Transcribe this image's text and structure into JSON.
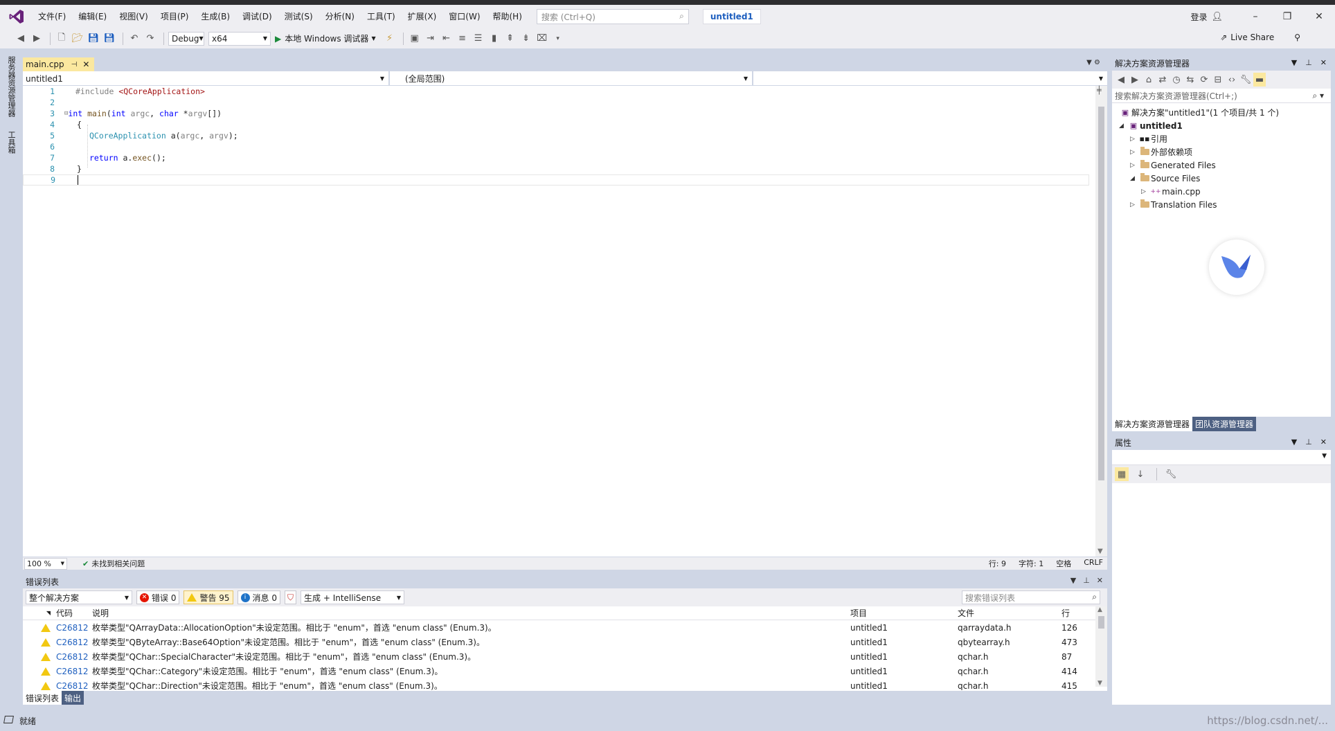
{
  "app": {
    "project_title": "untitled1",
    "login": "登录"
  },
  "menu": [
    "文件(F)",
    "编辑(E)",
    "视图(V)",
    "项目(P)",
    "生成(B)",
    "调试(D)",
    "测试(S)",
    "分析(N)",
    "工具(T)",
    "扩展(X)",
    "窗口(W)",
    "帮助(H)"
  ],
  "search": {
    "placeholder": "搜索 (Ctrl+Q)"
  },
  "toolbar": {
    "config": "Debug",
    "platform": "x64",
    "run_label": "本地 Windows 调试器",
    "live_share": "Live Share"
  },
  "left_strip": {
    "server_explorer": "服务器资源管理器",
    "toolbox": "工具箱"
  },
  "editor": {
    "tab_label": "main.cpp",
    "nav_project": "untitled1",
    "nav_scope": "(全局范围)",
    "line_numbers": [
      "1",
      "2",
      "3",
      "4",
      "5",
      "6",
      "7",
      "8",
      "9"
    ],
    "code": {
      "l1_pp": "#include ",
      "l1_inc": "<QCoreApplication>",
      "l3_kw1": "int",
      "l3_fn": " main",
      "l3_p1": "(",
      "l3_kw2": "int",
      "l3_param1": " argc",
      "l3_p2": ", ",
      "l3_kw3": "char",
      "l3_p3": " *",
      "l3_param2": "argv",
      "l3_p4": "[])",
      "l4": "{",
      "l5_ty": "QCoreApplication",
      "l5_rest1": " a(",
      "l5_param1": "argc",
      "l5_rest2": ", ",
      "l5_param2": "argv",
      "l5_rest3": ");",
      "l7_kw": "return",
      "l7_rest": " a.",
      "l7_fn": "exec",
      "l7_rest2": "();",
      "l8": "}"
    },
    "zoom": "100 %",
    "no_issues": "未找到相关问题",
    "row_info": "行: 9",
    "col_info": "字符: 1",
    "space_info": "空格",
    "eol_info": "CRLF"
  },
  "error_list": {
    "title": "错误列表",
    "scope": "整个解决方案",
    "errors_label": "错误 0",
    "warnings_label": "警告 95",
    "messages_label": "消息 0",
    "build_filter": "生成 + IntelliSense",
    "search_placeholder": "搜索错误列表",
    "headers": {
      "code": "代码",
      "desc": "说明",
      "project": "项目",
      "file": "文件",
      "line": "行"
    },
    "rows": [
      {
        "code": "C26812",
        "desc": "枚举类型\"QArrayData::AllocationOption\"未设定范围。相比于 \"enum\"，首选 \"enum class\" (Enum.3)。",
        "project": "untitled1",
        "file": "qarraydata.h",
        "line": "126"
      },
      {
        "code": "C26812",
        "desc": "枚举类型\"QByteArray::Base64Option\"未设定范围。相比于 \"enum\"，首选 \"enum class\" (Enum.3)。",
        "project": "untitled1",
        "file": "qbytearray.h",
        "line": "473"
      },
      {
        "code": "C26812",
        "desc": "枚举类型\"QChar::SpecialCharacter\"未设定范围。相比于 \"enum\"，首选 \"enum class\" (Enum.3)。",
        "project": "untitled1",
        "file": "qchar.h",
        "line": "87"
      },
      {
        "code": "C26812",
        "desc": "枚举类型\"QChar::Category\"未设定范围。相比于 \"enum\"，首选 \"enum class\" (Enum.3)。",
        "project": "untitled1",
        "file": "qchar.h",
        "line": "414"
      },
      {
        "code": "C26812",
        "desc": "枚举类型\"QChar::Direction\"未设定范围。相比于 \"enum\"，首选 \"enum class\" (Enum.3)。",
        "project": "untitled1",
        "file": "qchar.h",
        "line": "415"
      }
    ],
    "tabs": [
      "错误列表",
      "输出"
    ]
  },
  "solution_explorer": {
    "title": "解决方案资源管理器",
    "search_placeholder": "搜索解决方案资源管理器(Ctrl+;)",
    "solution_label": "解决方案\"untitled1\"(1 个项目/共 1 个)",
    "project_label": "untitled1",
    "items": [
      "引用",
      "外部依赖项",
      "Generated Files",
      "Source Files",
      "main.cpp",
      "Translation Files"
    ],
    "tabs": [
      "解决方案资源管理器",
      "团队资源管理器"
    ]
  },
  "properties": {
    "title": "属性"
  },
  "status": {
    "ready": "就绪",
    "watermark": "https://blog.csdn.net/..."
  },
  "colors": {
    "accent": "#007acc",
    "chrome": "#cfd6e5",
    "tab_active": "#fbe89f"
  }
}
